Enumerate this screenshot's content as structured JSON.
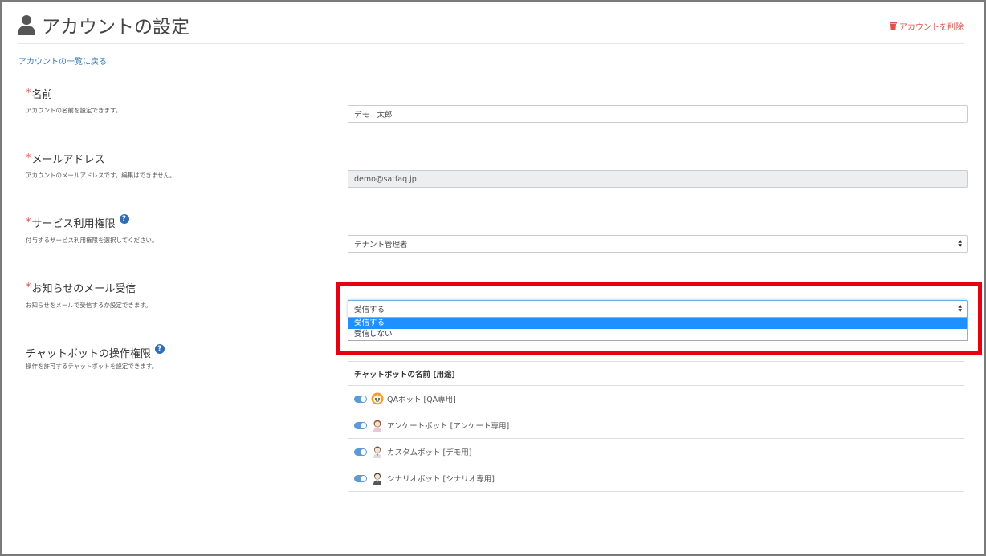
{
  "header": {
    "title": "アカウントの設定",
    "delete_label": "アカウントを削除",
    "user_icon": "user-icon",
    "delete_icon": "trash-icon"
  },
  "back_link": "アカウントの一覧に戻る",
  "required_mark": "*",
  "help_mark": "?",
  "fields": {
    "name": {
      "label": "名前",
      "desc": "アカウントの名前を設定できます。",
      "value": "デモ　太郎"
    },
    "email": {
      "label": "メールアドレス",
      "desc": "アカウントのメールアドレスです。編集はできません。",
      "value": "demo@satfaq.jp"
    },
    "permission": {
      "label": "サービス利用権限",
      "desc": "付与するサービス利用権限を選択してください。",
      "value": "テナント管理者"
    },
    "notify": {
      "label": "お知らせのメール受信",
      "desc": "お知らせをメールで受信するか設定できます。",
      "value": "受信する",
      "options": [
        "受信する",
        "受信しない"
      ]
    },
    "chatbot": {
      "label": "チャットボットの操作権限",
      "desc": "操作を許可するチャットボットを設定できます。"
    }
  },
  "bot_table": {
    "header": "チャットボットの名前 [用途]",
    "rows": [
      {
        "name": "QAボット [QA専用]",
        "enabled": true
      },
      {
        "name": "アンケートボット [アンケート専用]",
        "enabled": true
      },
      {
        "name": "カスタムボット [デモ用]",
        "enabled": true
      },
      {
        "name": "シナリオボット [シナリオ専用]",
        "enabled": true
      }
    ]
  },
  "colors": {
    "required": "#d9534f",
    "link": "#337ab7",
    "highlight": "#e60012",
    "selected_option": "#1e90ff",
    "toggle_on": "#5b9bd5"
  }
}
